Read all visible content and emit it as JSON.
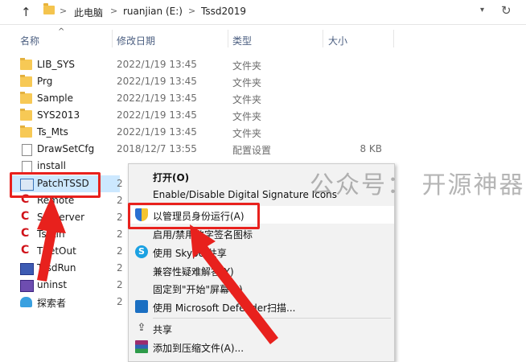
{
  "address": {
    "crumbs": [
      "此电脑",
      "ruanjian (E:)",
      "Tssd2019"
    ],
    "separator": ">"
  },
  "columns": {
    "name": "名称",
    "date": "修改日期",
    "type": "类型",
    "size": "大小"
  },
  "files": [
    {
      "name": "LIB_SYS",
      "date": "2022/1/19 13:45",
      "type": "文件夹",
      "size": "",
      "icon": "folder-icon"
    },
    {
      "name": "Prg",
      "date": "2022/1/19 13:45",
      "type": "文件夹",
      "size": "",
      "icon": "folder-icon"
    },
    {
      "name": "Sample",
      "date": "2022/1/19 13:45",
      "type": "文件夹",
      "size": "",
      "icon": "folder-icon"
    },
    {
      "name": "SYS2013",
      "date": "2022/1/19 13:45",
      "type": "文件夹",
      "size": "",
      "icon": "folder-icon"
    },
    {
      "name": "Ts_Mts",
      "date": "2022/1/19 13:45",
      "type": "文件夹",
      "size": "",
      "icon": "folder-icon"
    },
    {
      "name": "DrawSetCfg",
      "date": "2018/12/7 13:55",
      "type": "配置设置",
      "size": "8 KB",
      "icon": "config-file-icon"
    },
    {
      "name": "install",
      "date": "",
      "type": "",
      "size": "",
      "icon": "file-icon"
    },
    {
      "name": "PatchTSSD",
      "date": "2",
      "type": "",
      "size": "",
      "icon": "exe-icon"
    },
    {
      "name": "Remote",
      "date": "2",
      "type": "",
      "size": "",
      "icon": "tssd-app-icon"
    },
    {
      "name": "SetServer",
      "date": "2",
      "type": "",
      "size": "",
      "icon": "tssd-app-icon"
    },
    {
      "name": "Tsetin",
      "date": "2",
      "type": "",
      "size": "",
      "icon": "tssd-app-icon"
    },
    {
      "name": "TSetOut",
      "date": "2",
      "type": "",
      "size": "",
      "icon": "tssd-app-icon"
    },
    {
      "name": "TssdRun",
      "date": "2",
      "type": "",
      "size": "",
      "icon": "tssdrun-icon"
    },
    {
      "name": "uninst",
      "date": "2",
      "type": "",
      "size": "",
      "icon": "uninstall-icon"
    },
    {
      "name": "探索者",
      "date": "2",
      "type": "",
      "size": "",
      "icon": "explorer-app-icon"
    }
  ],
  "context_menu": {
    "open": "打开(O)",
    "signature": "Enable/Disable Digital Signature Icons",
    "run_as_admin": "以管理员身份运行(A)",
    "toggle_sign_icon": "启用/禁用数字签名图标",
    "skype_share": "使用 Skype 共享",
    "compat": "兼容性疑难解答(Y)",
    "pin_start": "固定到\"开始\"屏幕(P)",
    "defender_scan": "使用 Microsoft Defender扫描...",
    "share": "共享",
    "add_archive": "添加到压缩文件(A)..."
  },
  "watermark": "公众号：  开源神器",
  "colors": {
    "annotation_red": "#e8211d",
    "selection": "#cce8ff"
  }
}
